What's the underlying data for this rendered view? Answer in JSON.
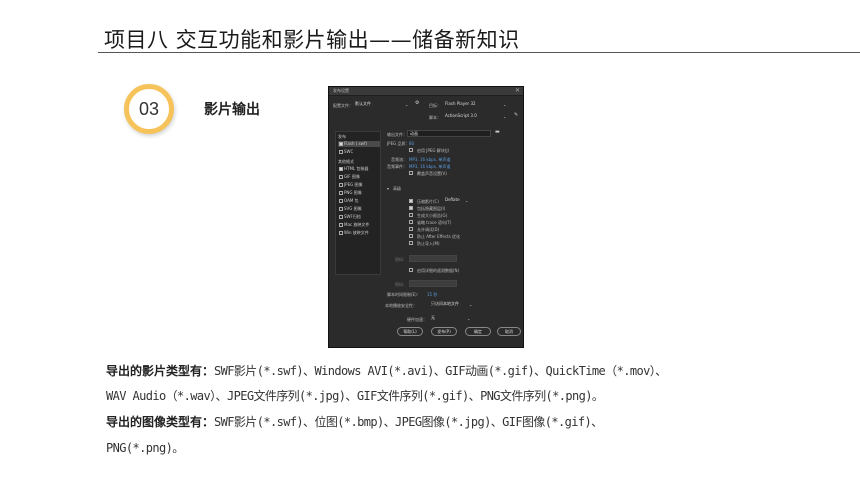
{
  "page": {
    "title": "项目八  交互功能和影片输出——储备新知识",
    "badge_number": "03",
    "section_label": "影片输出"
  },
  "dialog": {
    "title": "发布设置",
    "close_glyph": "✕",
    "profile_label": "配置文件：",
    "profile_value": "默认文件",
    "target_label": "目标：",
    "target_value": "Flash Player 32",
    "script_label": "脚本：",
    "script_value": "ActionScript 3.0",
    "sidebar": {
      "publish_heading": "发布",
      "items_publish": [
        {
          "label": "Flash (.swf)",
          "checked": true,
          "selected": true
        },
        {
          "label": "SWC",
          "checked": false,
          "selected": false
        }
      ],
      "other_heading": "其他格式",
      "items_other": [
        {
          "label": "HTML 包装器",
          "checked": true
        },
        {
          "label": "GIF 图像",
          "checked": false
        },
        {
          "label": "JPEG 图像",
          "checked": false
        },
        {
          "label": "PNG 图像",
          "checked": false
        },
        {
          "label": "OAM 包",
          "checked": false
        },
        {
          "label": "SVG 图像",
          "checked": false
        },
        {
          "label": "SWF归档",
          "checked": false
        },
        {
          "label": "Mac 放映文件",
          "checked": false
        },
        {
          "label": "Win 放映文件",
          "checked": false
        }
      ]
    },
    "output_label": "输出文件：",
    "output_value": "动画",
    "jpeg_label": "JPEG 品质：",
    "jpeg_value": "80",
    "enable_jpeg": "启用 JPEG 解块(J)",
    "audio_stream_label": "音频流：",
    "audio_stream_value": "MP3, 16 kbps, 单声道",
    "audio_event_label": "音频事件：",
    "audio_event_value": "MP3, 16 kbps, 单声道",
    "override_sound": "覆盖声音设置(V)",
    "advanced_heading": "高级",
    "advanced_options": [
      {
        "label": "压缩影片(C)",
        "checked": true
      },
      {
        "label": "包括隐藏图层(I)",
        "checked": true
      },
      {
        "label": "生成大小报告(G)",
        "checked": false
      },
      {
        "label": "省略 trace 语句(T)",
        "checked": false
      },
      {
        "label": "允许调试(D)",
        "checked": false
      },
      {
        "label": "防止 After Effects 优化",
        "checked": false
      },
      {
        "label": "防止导入(M)",
        "checked": false
      }
    ],
    "compress_value": "Deflate",
    "password_label": "密码：",
    "enable_telemetry": "启用详细的遥测数据(N)",
    "password2_label": "密码：",
    "script_time_label": "脚本时间限制(E)：",
    "script_time_value": "15 秒",
    "local_security_label": "本地播放安全性：",
    "local_security_value": "只访问本地文件",
    "hw_accel_label": "硬件加速：",
    "hw_accel_value": "无",
    "buttons": {
      "help": "帮助(L)",
      "publish": "发布(P)",
      "ok": "确定",
      "cancel": "取消"
    }
  },
  "body_text": {
    "movie_types_label": "导出的影片类型有：",
    "movie_types_line1": "SWF影片(*.swf)、Windows AVI(*.avi)、GIF动画(*.gif)、QuickTime（*.mov）、",
    "movie_types_line2": "WAV Audio（*.wav）、JPEG文件序列(*.jpg)、GIF文件序列(*.gif)、PNG文件序列(*.png)。",
    "image_types_label": "导出的图像类型有：",
    "image_types_line1": "SWF影片(*.swf)、位图(*.bmp)、JPEG图像(*.jpg)、GIF图像(*.gif)、",
    "image_types_line2": "PNG(*.png)。"
  }
}
